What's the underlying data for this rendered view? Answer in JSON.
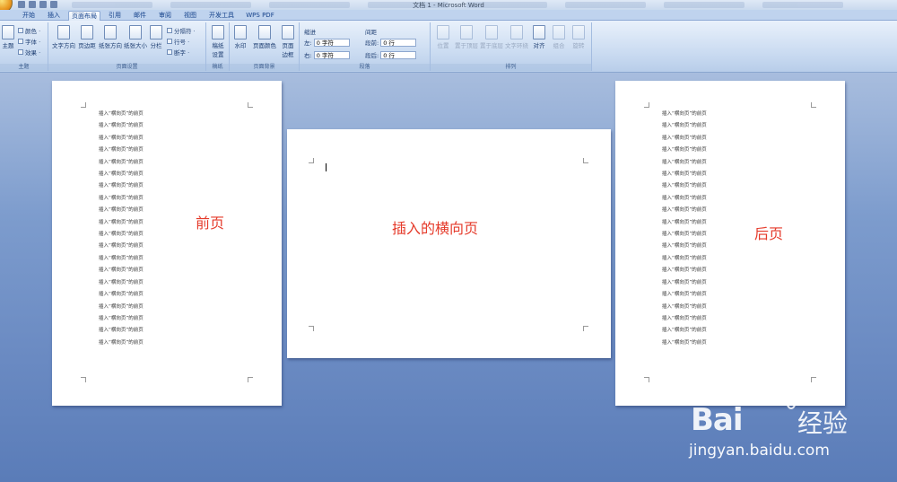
{
  "window": {
    "title": "文档 1 - Microsoft Word"
  },
  "tabs": [
    "开始",
    "插入",
    "页面布局",
    "引用",
    "邮件",
    "审阅",
    "视图",
    "开发工具",
    "WPS PDF"
  ],
  "active_tab": "页面布局",
  "ribbon": {
    "theme": {
      "label": "主题",
      "btn_themes": "主题",
      "colors": "颜色 ·",
      "fonts": "字体 ·",
      "effects": "效果 ·"
    },
    "page_setup": {
      "label": "页面设置",
      "text_dir": "文字方向",
      "margins": "页边距",
      "orientation": "纸张方向",
      "size": "纸张大小",
      "columns": "分栏",
      "breaks": "分隔符 ·",
      "line_numbers": "行号 ·",
      "hyphenation": "断字 ·"
    },
    "draft": {
      "label": "稿纸",
      "btn": "稿纸\n设置"
    },
    "page_background": {
      "label": "页面背景",
      "watermark": "水印",
      "page_color": "页面颜色",
      "borders": "页面\n边框"
    },
    "paragraph": {
      "label": "段落",
      "indent_head": "缩进",
      "spacing_head": "间距",
      "indent_left_label": "左:",
      "indent_left": "0 字符",
      "indent_right_label": "右:",
      "indent_right": "0 字符",
      "before_label": "段前:",
      "before": "0 行",
      "after_label": "段后:",
      "after": "0 行"
    },
    "arrange": {
      "label": "排列",
      "position": "位置",
      "front": "置于顶层",
      "back": "置于底层",
      "wrap": "文字环绕",
      "align": "对齐",
      "group": "组合",
      "rotate": "旋转"
    }
  },
  "document": {
    "line_text": "插入“横向页”的前页",
    "left_page_label": "前页",
    "middle_page_label": "插入的横向页",
    "right_page_label": "后页",
    "left_lines": [
      "插入“横向页”的前页",
      "插入“横向页”的前页",
      "插入“横向页”的前页",
      "插入“横向页”的前页",
      "插入“横向页”的前页",
      "插入“横向页”的前页",
      "插入“横向页”的前页",
      "插入“横向页”的前页",
      "插入“横向页”的前页",
      "插入“横向页”的前页",
      "插入“横向页”的前页",
      "插入“横向页”的前页",
      "插入“横向页”的前页",
      "插入“横向页”的前页",
      "插入“横向页”的前页",
      "插入“横向页”的前页",
      "插入“横向页”的前页",
      "插入“横向页”的前页",
      "插入“横向页”的前页",
      "插入“横向页”的前页"
    ],
    "right_lines": [
      "插入“横向页”的前页",
      "插入“横向页”的前页",
      "插入“横向页”的前页",
      "插入“横向页”的前页",
      "插入“横向页”的前页",
      "插入“横向页”的前页",
      "插入“横向页”的前页",
      "插入“横向页”的前页",
      "插入“横向页”的前页",
      "插入“横向页”的前页",
      "插入“横向页”的前页",
      "插入“横向页”的前页",
      "插入“横向页”的前页",
      "插入“横向页”的前页",
      "插入“横向页”的前页",
      "插入“横向页”的前页",
      "插入“横向页”的前页",
      "插入“横向页”的前页",
      "插入“横向页”的前页",
      "插入“横向页”的前页"
    ]
  },
  "watermark": {
    "brand": "Bai",
    "brand_cn": "经验",
    "url": "jingyan.baidu.com"
  }
}
